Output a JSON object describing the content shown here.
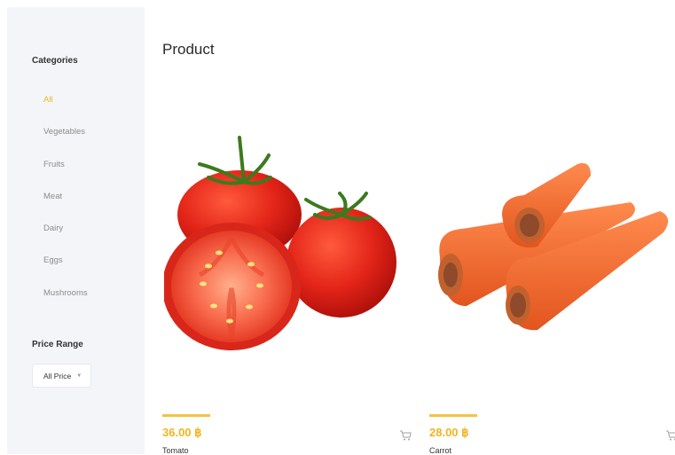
{
  "sidebar": {
    "categories_title": "Categories",
    "categories": [
      {
        "label": "All",
        "active": true
      },
      {
        "label": "Vegetables",
        "active": false
      },
      {
        "label": "Fruits",
        "active": false
      },
      {
        "label": "Meat",
        "active": false
      },
      {
        "label": "Dairy",
        "active": false
      },
      {
        "label": "Eggs",
        "active": false
      },
      {
        "label": "Mushrooms",
        "active": false
      }
    ],
    "price_title": "Price Range",
    "price_select": "All Price"
  },
  "main": {
    "title": "Product",
    "products": [
      {
        "name": "Tomato",
        "price": "36.00 ฿",
        "image": "tomato-image"
      },
      {
        "name": "Carrot",
        "price": "28.00 ฿",
        "image": "carrot-image"
      }
    ]
  },
  "colors": {
    "accent": "#f2b51e",
    "sidebar_bg": "#f3f5f8",
    "price_bar": "#f5c343"
  }
}
